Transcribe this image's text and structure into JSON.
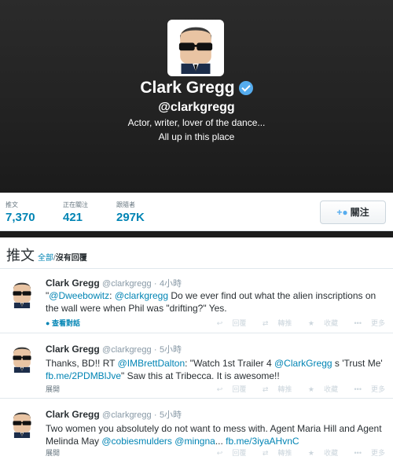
{
  "profile": {
    "name": "Clark Gregg",
    "handle": "@clarkgregg",
    "bio_line1": "Actor, writer, lover of the dance...",
    "bio_line2": "All up in this place"
  },
  "stats": [
    {
      "label": "推文",
      "value": "7,370"
    },
    {
      "label": "正在關注",
      "value": "421"
    },
    {
      "label": "跟隨者",
      "value": "297K"
    }
  ],
  "follow_button": {
    "label": "關注"
  },
  "timeline": {
    "title": "推文",
    "filter_all": "全部",
    "filter_sep": "/",
    "filter_no_replies": "沒有回覆"
  },
  "actions": {
    "reply": "回覆",
    "retweet": "轉推",
    "favorite": "收藏",
    "more": "更多"
  },
  "tweets": [
    {
      "name": "Clark Gregg",
      "handle": "@clarkgregg",
      "time": "4小時",
      "parts": [
        "\"",
        "@Dweebowitz",
        ": ",
        "@clarkgregg",
        " Do we ever find out what the alien inscriptions on the wall were when Phil was \"drifting?\" Yes."
      ],
      "footer": "查看對話"
    },
    {
      "name": "Clark Gregg",
      "handle": "@clarkgregg",
      "time": "5小時",
      "parts": [
        "Thanks, BD!! RT ",
        "@IMBrettDalton",
        ": \"Watch 1st Trailer 4 ",
        "@ClarkGregg",
        " s 'Trust Me' ",
        "fb.me/2PDMBlJve",
        "\" Saw this at Tribecca. It is awesome!!"
      ],
      "footer": "展開"
    },
    {
      "name": "Clark Gregg",
      "handle": "@clarkgregg",
      "time": "5小時",
      "parts": [
        "Two women you absolutely do not want to mess with. Agent Maria Hill and Agent Melinda May ",
        "@cobiesmulders",
        " ",
        "@mingna",
        "... ",
        "fb.me/3iyaAHvnC"
      ],
      "footer": "展開"
    }
  ],
  "colors": {
    "accent": "#0084b4",
    "verified": "#55acee",
    "header_bg": "#222222"
  },
  "icons": {
    "verified": "verified-badge-icon",
    "follow": "add-user-icon",
    "reply": "reply-icon",
    "retweet": "retweet-icon",
    "favorite": "star-icon",
    "more": "more-dots-icon",
    "conversation": "speech-bubble-icon"
  }
}
